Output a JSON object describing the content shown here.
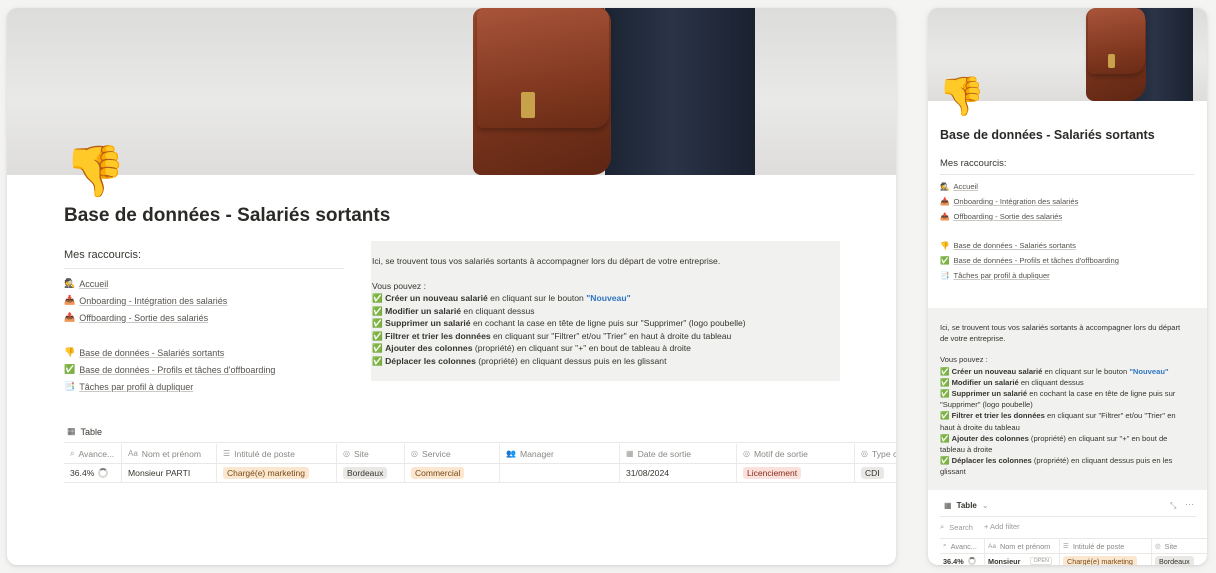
{
  "page": {
    "icon": "👎",
    "title": "Base de données - Salariés sortants"
  },
  "shortcuts": {
    "heading": "Mes raccourcis:",
    "items": [
      {
        "emoji": "🕵️",
        "label": "Accueil"
      },
      {
        "emoji": "📥",
        "label": "Onboarding - Intégration des salariés"
      },
      {
        "emoji": "📤",
        "label": "Offboarding - Sortie des salariés"
      },
      {
        "emoji": "👎",
        "label": "Base de données - Salariés sortants"
      },
      {
        "emoji": "✅",
        "label": "Base de données - Profils et tâches d'offboarding"
      },
      {
        "emoji": "📑",
        "label": "Tâches par profil à dupliquer"
      }
    ]
  },
  "callout": {
    "intro": "Ici, se trouvent tous vos salariés sortants à accompagner lors du départ de votre entreprise.",
    "intro_mobile_1": "Ici, se trouvent tous vos salariés sortants à accompagner lors du départ",
    "intro_mobile_2": "de votre entreprise.",
    "vous_pouvez": "Vous pouvez :",
    "check_emoji": "✅",
    "items": [
      {
        "bold": "Créer un nouveau salarié",
        "rest": " en cliquant sur le bouton ",
        "blue": "\"Nouveau\""
      },
      {
        "bold": "Modifier un salarié",
        "rest": " en cliquant dessus"
      },
      {
        "bold": "Supprimer un salarié",
        "rest": " en cochant la case en tête de ligne puis sur \"Supprimer\" (logo poubelle)"
      },
      {
        "bold": "Filtrer et trier les données",
        "rest": " en cliquant sur \"Filtrer\" et/ou \"Trier\" en haut à droite du tableau"
      },
      {
        "bold": "Ajouter des colonnes",
        "rest": " (propriété) en cliquant sur \"+\" en bout de tableau à droite"
      },
      {
        "bold": "Déplacer les colonnes",
        "rest": " (propriété) en cliquant dessus puis en les glissant"
      }
    ],
    "mobile_items": [
      {
        "bold": "Créer un nouveau salarié",
        "rest": " en cliquant sur le bouton ",
        "blue": "\"Nouveau\""
      },
      {
        "bold": "Modifier un salarié",
        "rest": " en cliquant dessus"
      },
      {
        "bold": "Supprimer un salarié",
        "rest": " en cochant la case en tête de ligne puis sur",
        "line2": "\"Supprimer\" (logo poubelle)"
      },
      {
        "bold": "Filtrer et trier les données",
        "rest": " en cliquant sur \"Filtrer\" et/ou \"Trier\" en",
        "line2": "haut à droite du tableau"
      },
      {
        "bold": "Ajouter des colonnes",
        "rest": " (propriété) en cliquant sur \"+\" en bout de",
        "line2": "tableau à droite"
      },
      {
        "bold": "Déplacer les colonnes",
        "rest": " (propriété) en cliquant dessus puis en les",
        "line2": "glissant"
      }
    ]
  },
  "table": {
    "view_label": "Table",
    "columns": [
      "Avance...",
      "Nom et prénom",
      "Intitulé de poste",
      "Site",
      "Service",
      "Manager",
      "Date de sortie",
      "Motif de sortie",
      "Type c"
    ],
    "row": {
      "progress": "36.4%",
      "name": "Monsieur PARTI",
      "poste": "Chargé(e) marketing",
      "site": "Bordeaux",
      "service": "Commercial",
      "manager": "",
      "date": "31/08/2024",
      "motif": "Licenciement",
      "type": "CDI"
    }
  },
  "mobile": {
    "view_label": "Table",
    "chevron": "⌄",
    "search": "Search",
    "add_filter": "+ Add filter",
    "columns": [
      "Avanc...",
      "Nom et prénom",
      "Intitulé de poste",
      "Site"
    ],
    "row": {
      "progress": "36.4%",
      "name": "Monsieur",
      "open": "OPEN",
      "poste": "Chargé(e) marketing",
      "site": "Bordeaux"
    }
  },
  "colors": {
    "tag_orange": "#fbe7cf",
    "tag_orange_text": "#7a4a17",
    "tag_gray": "#e9e8e5",
    "tag_red": "#fbe1dc",
    "tag_red_text": "#8a2b1e",
    "callout_bg": "#f1f1ef",
    "link_blue": "#2f76c0"
  }
}
